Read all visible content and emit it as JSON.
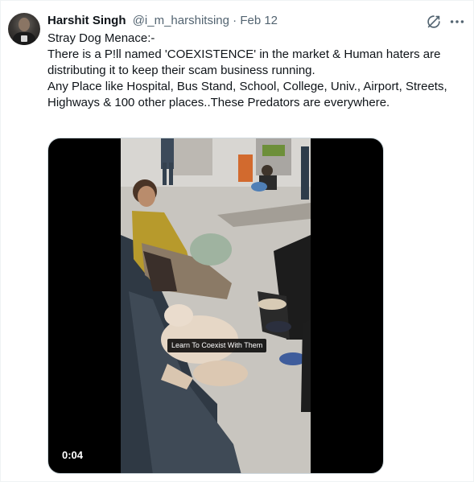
{
  "tweet": {
    "author_name": "Harshit Singh",
    "author_handle": "@i_m_harshitsing",
    "separator": "·",
    "date": "Feb 12",
    "text_lines": [
      "Stray Dog Menace:-",
      "",
      "There is a P!ll named 'COEXISTENCE' in the market & Human haters are",
      "distributing it to keep their scam business running.",
      "Any Place like Hospital, Bus Stand, School, College, Univ., Airport, Streets,",
      "Highways & 100 other places..These Predators are everywhere."
    ],
    "icons": {
      "grok": "grok-icon",
      "more": "more-icon"
    }
  },
  "media": {
    "video_caption": "Learn To Coexist With Them",
    "video_time": "0:04"
  }
}
